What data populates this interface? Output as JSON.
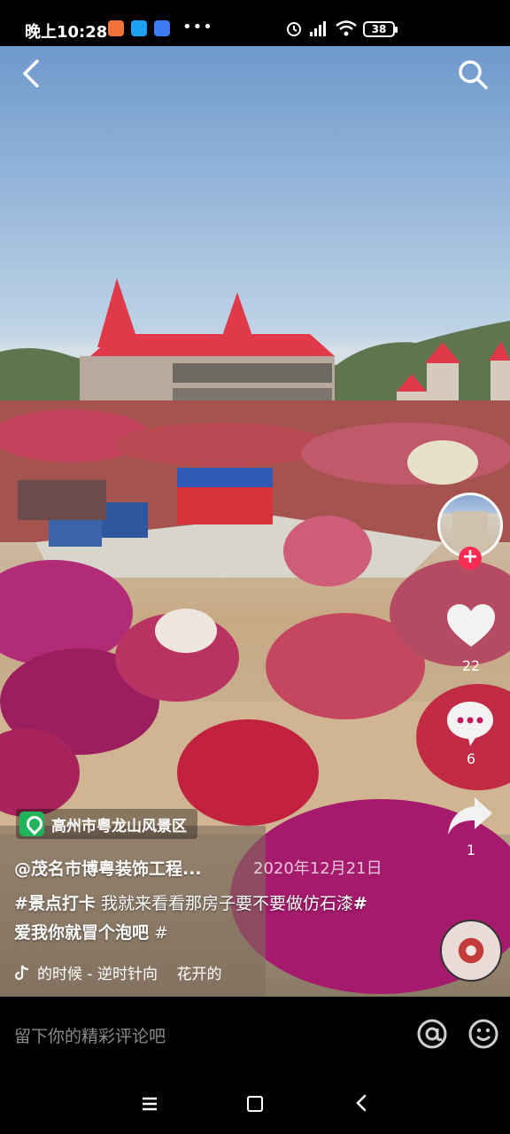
{
  "status_bar": {
    "time": "晚上10:28",
    "more": "•••",
    "battery": "38"
  },
  "video": {
    "location": "高州市粤龙山风景区",
    "author": "@茂名市博粤装饰工程...",
    "date": "2020年12月21日",
    "caption_tag1": "#景点打卡",
    "caption_text1": " 我就来看看那房子要不要做仿石漆",
    "caption_tag2": "#爱我你就冒个泡吧",
    "caption_text2": " #",
    "music_title": "的时候 - 逆时针向    花开的"
  },
  "actions": {
    "follow_label": "+",
    "like_count": "22",
    "comment_count": "6",
    "share_count": "1"
  },
  "comment_bar": {
    "placeholder": "留下你的精彩评论吧"
  },
  "icons": {
    "back": "chevron-left-icon",
    "search": "search-icon",
    "like": "heart-icon",
    "comment": "comment-bubble-icon",
    "share": "share-arrow-icon",
    "at": "at-icon",
    "emoji": "emoji-icon"
  },
  "colors": {
    "follow": "#fe2c55",
    "location_badge": "#21b35a"
  }
}
